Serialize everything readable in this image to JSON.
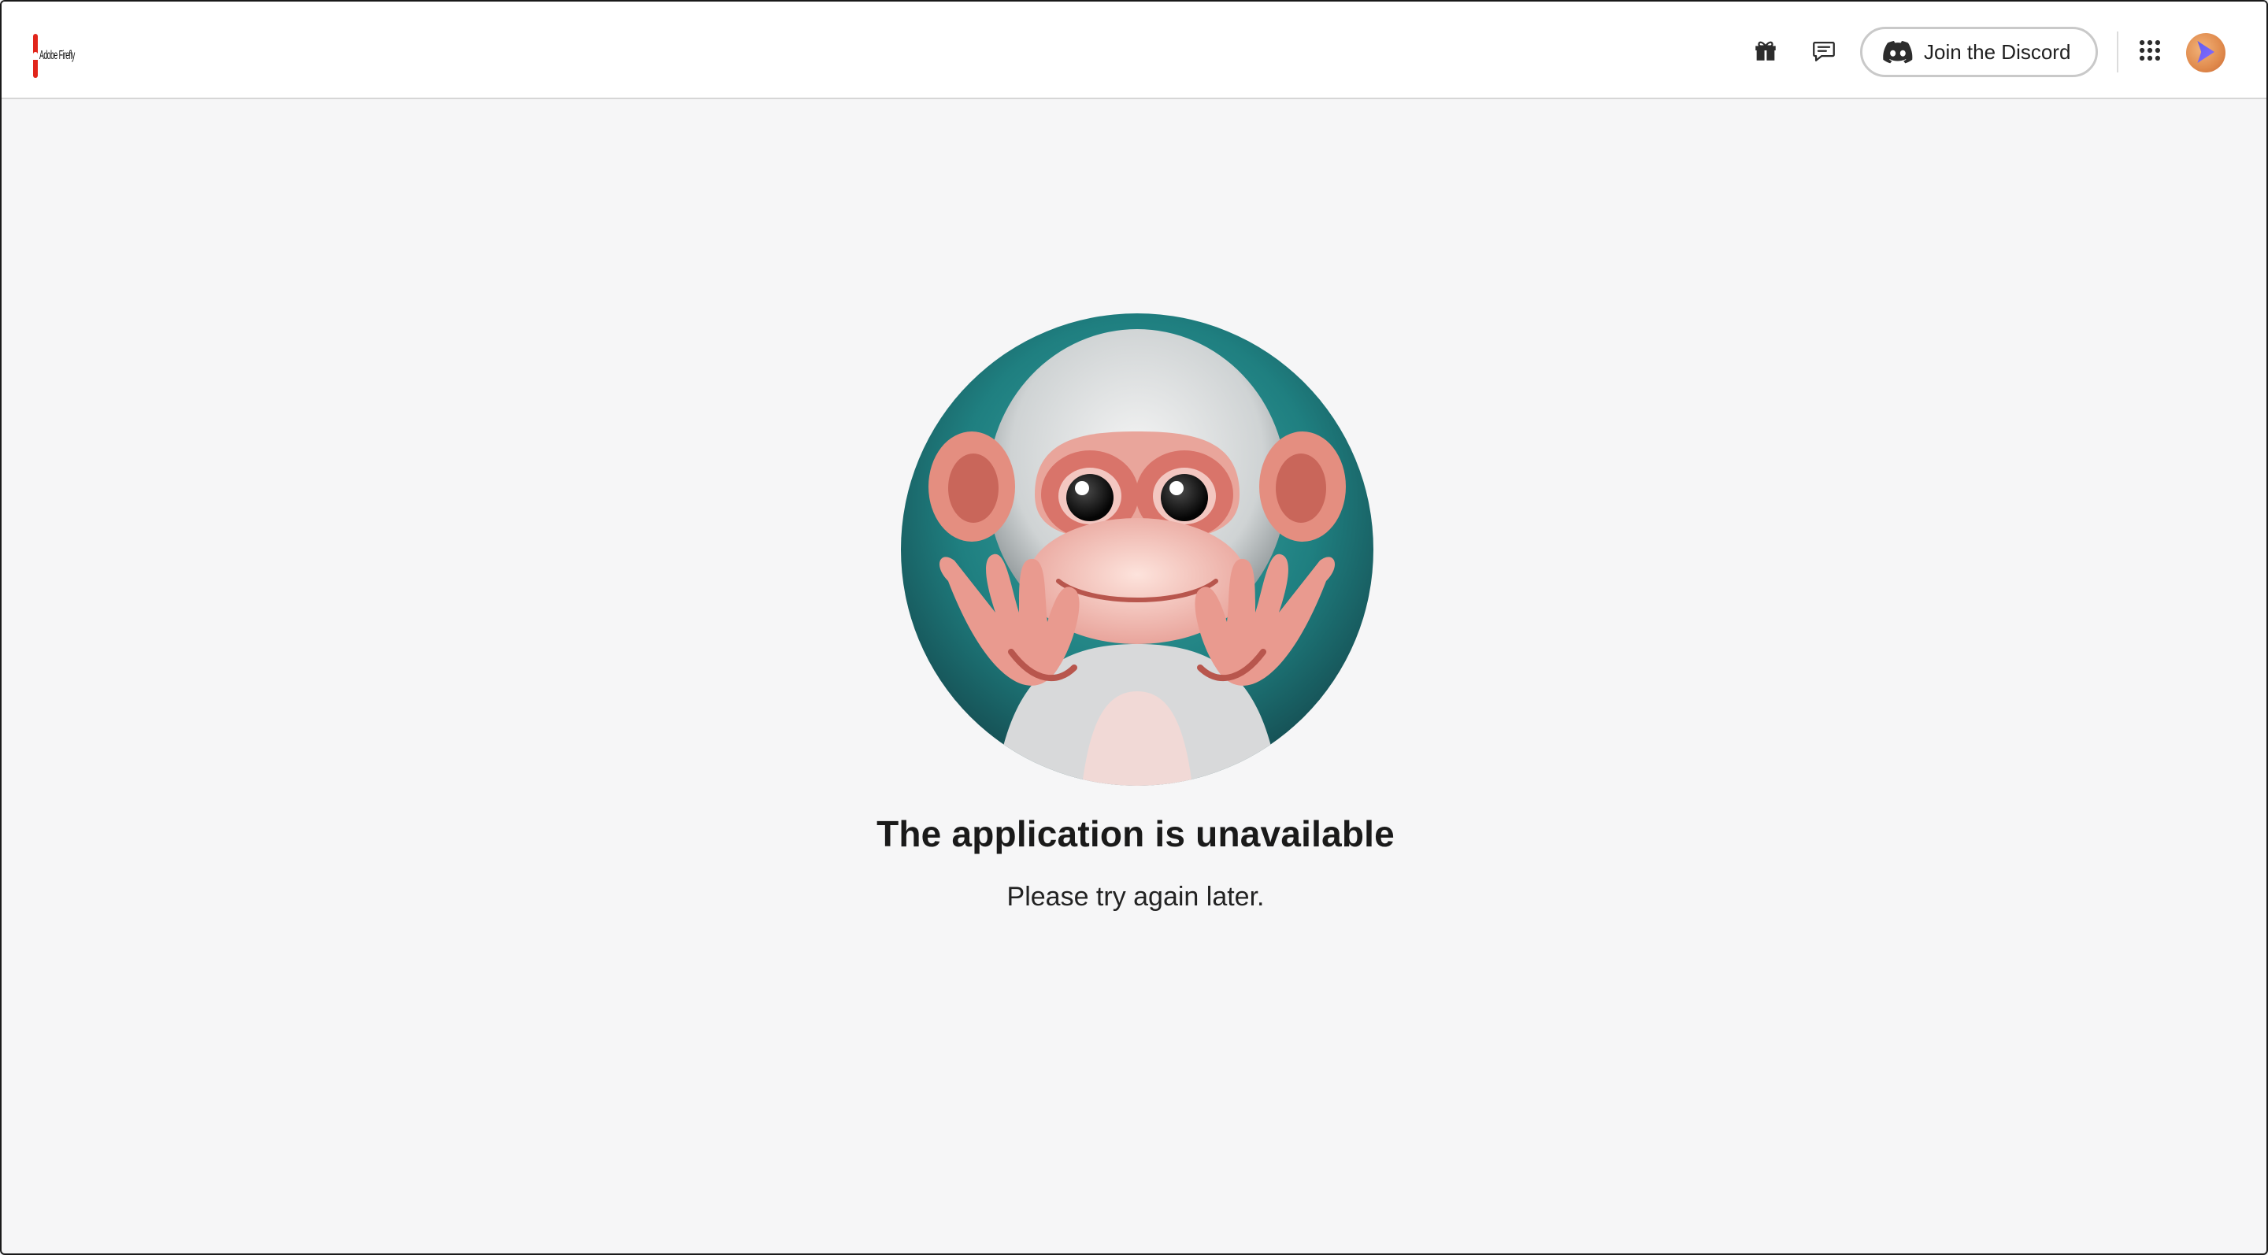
{
  "header": {
    "logo_text": "Adobe Firefly",
    "discord_label": "Join the Discord",
    "icons": [
      "gift-icon",
      "feedback-icon",
      "discord-icon",
      "apps-grid-icon"
    ]
  },
  "main": {
    "title": "The application is unavailable",
    "subtitle": "Please try again later."
  },
  "colors": {
    "brand_red": "#e1251b",
    "page_bg": "#f6f6f7",
    "hero_teal": "#1f7f80"
  }
}
